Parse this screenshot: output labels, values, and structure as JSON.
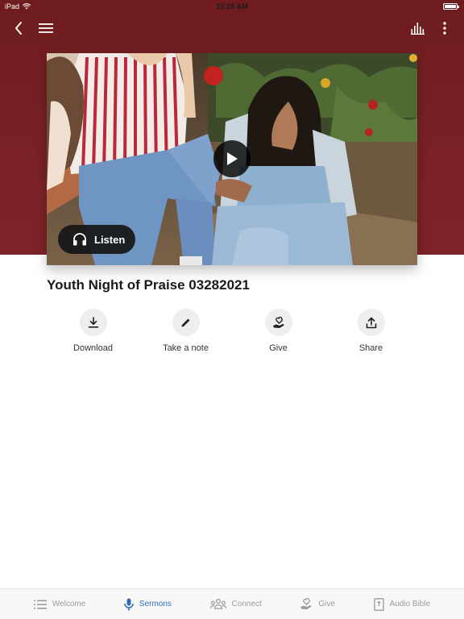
{
  "status_bar": {
    "device": "iPad",
    "time": "10:26 AM"
  },
  "nav": {
    "back_icon": "chevron-left-icon",
    "menu_icon": "hamburger-menu-icon",
    "audio_icon": "equalizer-icon",
    "more_icon": "more-vertical-icon"
  },
  "hero": {
    "listen_label": "Listen"
  },
  "sermon": {
    "title": "Youth Night of Praise 03282021"
  },
  "actions": [
    {
      "label": "Download",
      "icon": "download-icon"
    },
    {
      "label": "Take a note",
      "icon": "pencil-icon"
    },
    {
      "label": "Give",
      "icon": "give-hand-icon"
    },
    {
      "label": "Share",
      "icon": "share-icon"
    }
  ],
  "tabs": [
    {
      "label": "Welcome",
      "icon": "list-icon",
      "active": false
    },
    {
      "label": "Sermons",
      "icon": "microphone-icon",
      "active": true
    },
    {
      "label": "Connect",
      "icon": "people-icon",
      "active": false
    },
    {
      "label": "Give",
      "icon": "give-hand-icon",
      "active": false
    },
    {
      "label": "Audio Bible",
      "icon": "bible-icon",
      "active": false
    }
  ],
  "colors": {
    "header": "#7a2226",
    "active_tab": "#2d6fb3",
    "inactive_tab": "#9a9a9a"
  }
}
